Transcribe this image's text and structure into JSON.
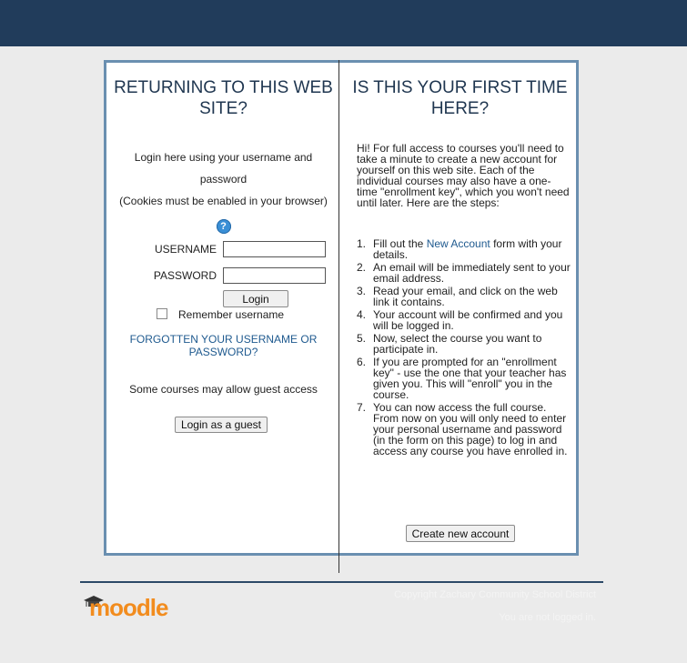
{
  "colors": {
    "topbar": "#213c5b",
    "background": "#ebebeb",
    "box_border": "#6a8fb0",
    "link": "#1f5a8f",
    "heading": "#1f3650",
    "logo": "#f28c1e"
  },
  "login": {
    "heading": "RETURNING TO THIS WEB SITE?",
    "intro_line1": "Login here using your username and password",
    "intro_line2": "(Cookies must be enabled in your browser)",
    "help_icon": "help-icon",
    "username_label": "USERNAME",
    "username_value": "",
    "password_label": "PASSWORD",
    "password_value": "",
    "login_button": "Login",
    "remember_label": "Remember username",
    "forgot_link": "FORGOTTEN YOUR USERNAME OR PASSWORD?",
    "guest_text": "Some courses may allow guest access",
    "guest_button": "Login as a guest"
  },
  "signup": {
    "heading": "IS THIS YOUR FIRST TIME HERE?",
    "intro": "Hi! For full access to courses you'll need to take a minute to create a new account for yourself on this web site. Each of the individual courses may also have a one-time \"enrollment key\", which you won't need until later. Here are the steps:",
    "steps": [
      {
        "num": "1.",
        "pre": "Fill out the ",
        "link": "New Account",
        "post": " form with your details."
      },
      {
        "num": "2.",
        "text": "An email will be immediately sent to your email address."
      },
      {
        "num": "3.",
        "text": "Read your email, and click on the web link it contains."
      },
      {
        "num": "4.",
        "text": "Your account will be confirmed and you will be logged in."
      },
      {
        "num": "5.",
        "text": "Now, select the course you want to participate in."
      },
      {
        "num": "6.",
        "text": "If you are prompted for an \"enrollment key\" - use the one that your teacher has given you. This will \"enroll\" you in the course."
      },
      {
        "num": "7.",
        "text": "You can now access the full course. From now on you will only need to enter your personal username and password (in the form on this page) to log in and access any course you have enrolled in."
      }
    ],
    "create_button": "Create new account"
  },
  "footer": {
    "logo_text": "moodle",
    "copyright": "Copyright Zachary Community School District",
    "login_status": "You are not logged in."
  }
}
